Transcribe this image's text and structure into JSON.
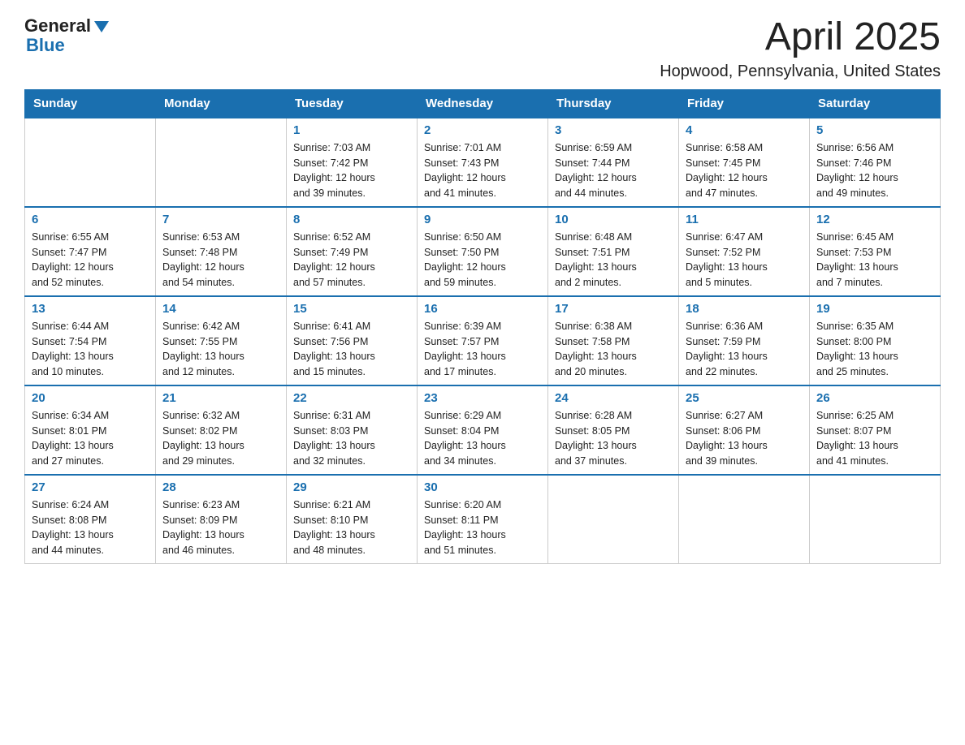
{
  "header": {
    "logo": {
      "general": "General",
      "blue": "Blue"
    },
    "title": "April 2025",
    "location": "Hopwood, Pennsylvania, United States"
  },
  "days_of_week": [
    "Sunday",
    "Monday",
    "Tuesday",
    "Wednesday",
    "Thursday",
    "Friday",
    "Saturday"
  ],
  "weeks": [
    [
      {
        "day": "",
        "info": ""
      },
      {
        "day": "",
        "info": ""
      },
      {
        "day": "1",
        "info": "Sunrise: 7:03 AM\nSunset: 7:42 PM\nDaylight: 12 hours\nand 39 minutes."
      },
      {
        "day": "2",
        "info": "Sunrise: 7:01 AM\nSunset: 7:43 PM\nDaylight: 12 hours\nand 41 minutes."
      },
      {
        "day": "3",
        "info": "Sunrise: 6:59 AM\nSunset: 7:44 PM\nDaylight: 12 hours\nand 44 minutes."
      },
      {
        "day": "4",
        "info": "Sunrise: 6:58 AM\nSunset: 7:45 PM\nDaylight: 12 hours\nand 47 minutes."
      },
      {
        "day": "5",
        "info": "Sunrise: 6:56 AM\nSunset: 7:46 PM\nDaylight: 12 hours\nand 49 minutes."
      }
    ],
    [
      {
        "day": "6",
        "info": "Sunrise: 6:55 AM\nSunset: 7:47 PM\nDaylight: 12 hours\nand 52 minutes."
      },
      {
        "day": "7",
        "info": "Sunrise: 6:53 AM\nSunset: 7:48 PM\nDaylight: 12 hours\nand 54 minutes."
      },
      {
        "day": "8",
        "info": "Sunrise: 6:52 AM\nSunset: 7:49 PM\nDaylight: 12 hours\nand 57 minutes."
      },
      {
        "day": "9",
        "info": "Sunrise: 6:50 AM\nSunset: 7:50 PM\nDaylight: 12 hours\nand 59 minutes."
      },
      {
        "day": "10",
        "info": "Sunrise: 6:48 AM\nSunset: 7:51 PM\nDaylight: 13 hours\nand 2 minutes."
      },
      {
        "day": "11",
        "info": "Sunrise: 6:47 AM\nSunset: 7:52 PM\nDaylight: 13 hours\nand 5 minutes."
      },
      {
        "day": "12",
        "info": "Sunrise: 6:45 AM\nSunset: 7:53 PM\nDaylight: 13 hours\nand 7 minutes."
      }
    ],
    [
      {
        "day": "13",
        "info": "Sunrise: 6:44 AM\nSunset: 7:54 PM\nDaylight: 13 hours\nand 10 minutes."
      },
      {
        "day": "14",
        "info": "Sunrise: 6:42 AM\nSunset: 7:55 PM\nDaylight: 13 hours\nand 12 minutes."
      },
      {
        "day": "15",
        "info": "Sunrise: 6:41 AM\nSunset: 7:56 PM\nDaylight: 13 hours\nand 15 minutes."
      },
      {
        "day": "16",
        "info": "Sunrise: 6:39 AM\nSunset: 7:57 PM\nDaylight: 13 hours\nand 17 minutes."
      },
      {
        "day": "17",
        "info": "Sunrise: 6:38 AM\nSunset: 7:58 PM\nDaylight: 13 hours\nand 20 minutes."
      },
      {
        "day": "18",
        "info": "Sunrise: 6:36 AM\nSunset: 7:59 PM\nDaylight: 13 hours\nand 22 minutes."
      },
      {
        "day": "19",
        "info": "Sunrise: 6:35 AM\nSunset: 8:00 PM\nDaylight: 13 hours\nand 25 minutes."
      }
    ],
    [
      {
        "day": "20",
        "info": "Sunrise: 6:34 AM\nSunset: 8:01 PM\nDaylight: 13 hours\nand 27 minutes."
      },
      {
        "day": "21",
        "info": "Sunrise: 6:32 AM\nSunset: 8:02 PM\nDaylight: 13 hours\nand 29 minutes."
      },
      {
        "day": "22",
        "info": "Sunrise: 6:31 AM\nSunset: 8:03 PM\nDaylight: 13 hours\nand 32 minutes."
      },
      {
        "day": "23",
        "info": "Sunrise: 6:29 AM\nSunset: 8:04 PM\nDaylight: 13 hours\nand 34 minutes."
      },
      {
        "day": "24",
        "info": "Sunrise: 6:28 AM\nSunset: 8:05 PM\nDaylight: 13 hours\nand 37 minutes."
      },
      {
        "day": "25",
        "info": "Sunrise: 6:27 AM\nSunset: 8:06 PM\nDaylight: 13 hours\nand 39 minutes."
      },
      {
        "day": "26",
        "info": "Sunrise: 6:25 AM\nSunset: 8:07 PM\nDaylight: 13 hours\nand 41 minutes."
      }
    ],
    [
      {
        "day": "27",
        "info": "Sunrise: 6:24 AM\nSunset: 8:08 PM\nDaylight: 13 hours\nand 44 minutes."
      },
      {
        "day": "28",
        "info": "Sunrise: 6:23 AM\nSunset: 8:09 PM\nDaylight: 13 hours\nand 46 minutes."
      },
      {
        "day": "29",
        "info": "Sunrise: 6:21 AM\nSunset: 8:10 PM\nDaylight: 13 hours\nand 48 minutes."
      },
      {
        "day": "30",
        "info": "Sunrise: 6:20 AM\nSunset: 8:11 PM\nDaylight: 13 hours\nand 51 minutes."
      },
      {
        "day": "",
        "info": ""
      },
      {
        "day": "",
        "info": ""
      },
      {
        "day": "",
        "info": ""
      }
    ]
  ]
}
